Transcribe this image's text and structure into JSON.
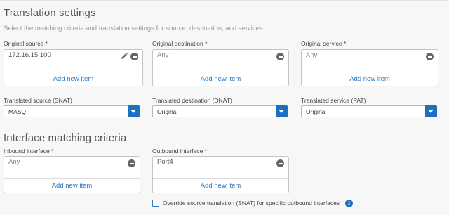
{
  "translation": {
    "title": "Translation settings",
    "subtitle": "Select the matching criteria and translation settings for source, destination, and services.",
    "original_source": {
      "label": "Original source *",
      "value": "172.16.15.100",
      "add": "Add new item"
    },
    "original_destination": {
      "label": "Original destination *",
      "value": "Any",
      "add": "Add new item"
    },
    "original_service": {
      "label": "Original service *",
      "value": "Any",
      "add": "Add new item"
    },
    "translated_source": {
      "label": "Translated source (SNAT)",
      "value": "MASQ"
    },
    "translated_destination": {
      "label": "Translated destination (DNAT)",
      "value": "Original"
    },
    "translated_service": {
      "label": "Translated service (PAT)",
      "value": "Original"
    }
  },
  "interface": {
    "title": "Interface matching criteria",
    "inbound": {
      "label": "Inbound interface *",
      "value": "Any",
      "add": "Add new item"
    },
    "outbound": {
      "label": "Outbound interface *",
      "value": "Port4",
      "add": "Add new item"
    },
    "override_label": "Override source translation (SNAT) for specific outbound interfaces"
  },
  "icons": {
    "remove": "minus-circle-icon",
    "edit": "pencil-icon",
    "dropdown": "chevron-down-icon",
    "info": "info-icon"
  },
  "colors": {
    "accent": "#1f6fc1",
    "link": "#2b7bc4"
  }
}
